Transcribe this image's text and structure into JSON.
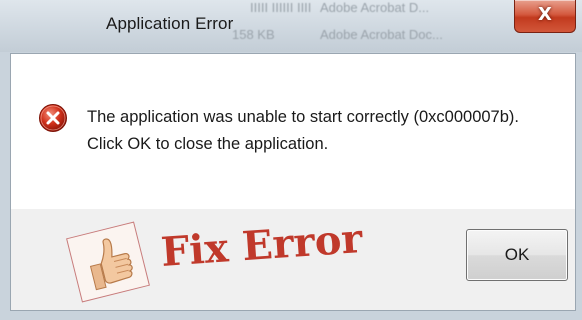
{
  "background": {
    "blurred_text_row1": [
      "IIIIII IIIIII",
      "IIIII IIIIII IIII",
      "Adobe Acrobat D..."
    ],
    "blurred_text_row2": [
      "158 KB",
      "Adobe Acrobat Doc..."
    ]
  },
  "dialog": {
    "title": "Application Error",
    "close_label": "X",
    "message": "The application was unable to start correctly (0xc000007b). Click OK to close the application.",
    "ok_label": "OK"
  },
  "overlay": {
    "fix_error_text": "Fix Error",
    "thumb_icon": "thumbs-up-icon"
  },
  "colors": {
    "error_red": "#c0392b",
    "close_button_red": "#c23a1e",
    "titlebar_glass": "#cfd8e0"
  }
}
